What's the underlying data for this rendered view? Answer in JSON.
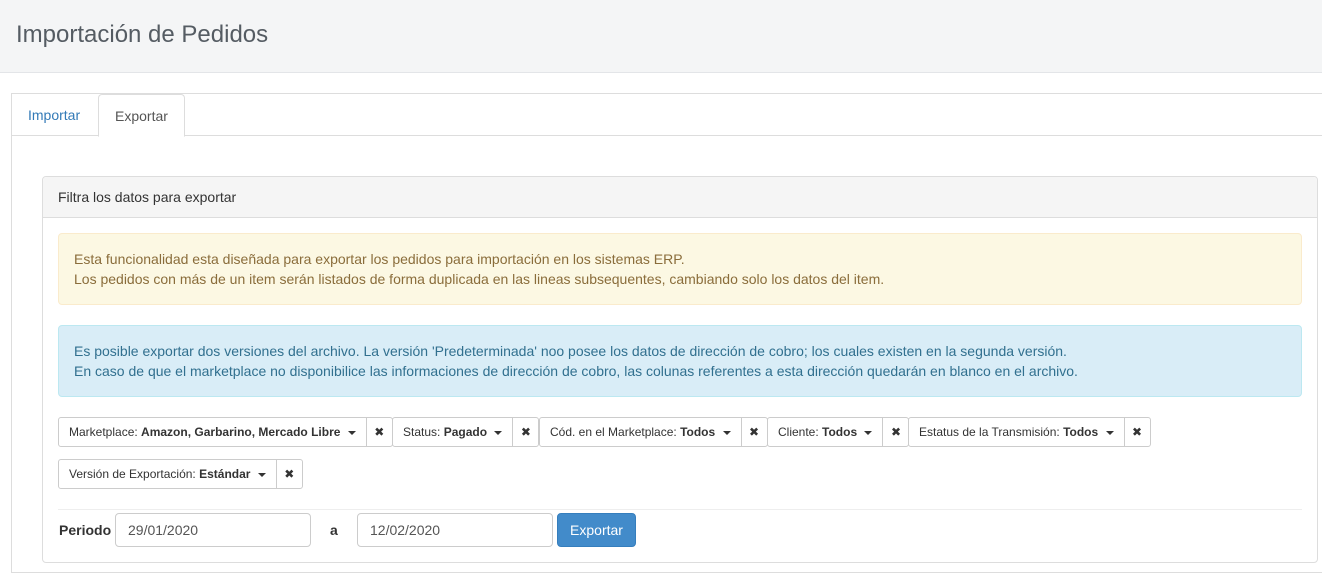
{
  "page": {
    "title": "Importación de Pedidos"
  },
  "tabs": [
    {
      "label": "Importar",
      "active": false
    },
    {
      "label": "Exportar",
      "active": true
    }
  ],
  "panel": {
    "heading": "Filtra los datos para exportar",
    "warning": {
      "line1": "Esta funcionalidad esta diseñada para exportar los pedidos para importación en los sistemas ERP.",
      "line2": "Los pedidos con más de un item serán listados de forma duplicada en las lineas subsequentes, cambiando solo los datos del item."
    },
    "info": {
      "line1": "Es posible exportar dos versiones del archivo. La versión 'Predeterminada' noo posee los datos de dirección de cobro; los cuales existen en la segunda versión.",
      "line2": "En caso de que el marketplace no disponibilice las informaciones de dirección de cobro, las colunas referentes a esta dirección quedarán en blanco en el archivo."
    },
    "filters": [
      {
        "label": "Marketplace:",
        "value": "Amazon, Garbarino, Mercado Libre"
      },
      {
        "label": "Status:",
        "value": "Pagado"
      },
      {
        "label": "Cód. en el Marketplace:",
        "value": "Todos"
      },
      {
        "label": "Cliente:",
        "value": "Todos"
      },
      {
        "label": "Estatus de la Transmisión:",
        "value": "Todos"
      },
      {
        "label": "Versión de Exportación:",
        "value": "Estándar"
      }
    ],
    "remove_icon": "✖",
    "period": {
      "label": "Periodo",
      "from": "29/01/2020",
      "separator": "a",
      "to": "12/02/2020"
    },
    "export_button": "Exportar"
  },
  "colors": {
    "primary": "#428bca",
    "link": "#337ab7",
    "warning_bg": "#fcf8e3",
    "info_bg": "#d9edf7"
  }
}
